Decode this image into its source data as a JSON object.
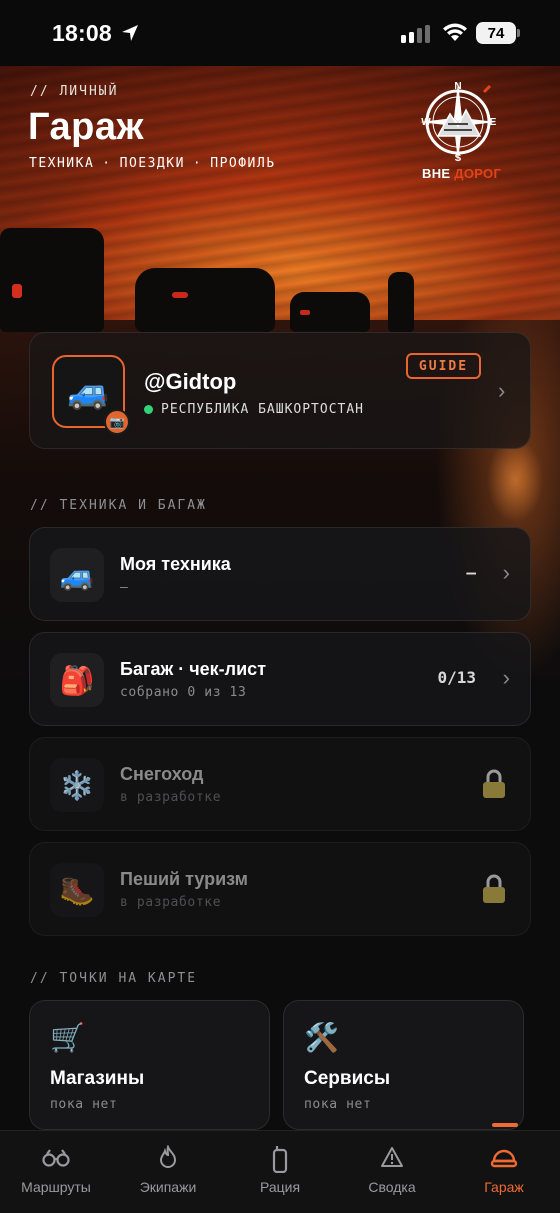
{
  "status": {
    "time": "18:08",
    "battery": "74"
  },
  "header": {
    "tag": "// ЛИЧНЫЙ",
    "title": "Гараж",
    "nav": [
      "ТЕХНИКА",
      "·",
      "ПОЕЗДКИ",
      "·",
      "ПРОФИЛЬ"
    ],
    "logo": {
      "compass": [
        "N",
        "W",
        "E",
        "S"
      ],
      "text_white": "ВНЕ",
      "text_red": "ДОРОГ"
    }
  },
  "profile": {
    "avatar_emoji": "🚙",
    "camera_emoji": "📷",
    "username": "@Gidtop",
    "region": "РЕСПУБЛИКА БАШКОРТОСТАН",
    "badge": "GUIDE",
    "online_color": "#33d17a"
  },
  "section_gear": {
    "title": "// ТЕХНИКА И БАГАЖ",
    "items": [
      {
        "emoji": "🚙",
        "title": "Моя техника",
        "subtitle": "—",
        "value": "—",
        "locked": false
      },
      {
        "emoji": "🎒",
        "title": "Багаж · чек-лист",
        "subtitle": "собрано 0 из 13",
        "value": "0/13",
        "locked": false
      },
      {
        "emoji": "❄️",
        "title": "Снегоход",
        "subtitle": "в разработке",
        "locked": true
      },
      {
        "emoji": "🥾",
        "title": "Пеший туризм",
        "subtitle": "в разработке",
        "locked": true
      }
    ]
  },
  "section_map": {
    "title": "// ТОЧКИ НА КАРТЕ",
    "tiles": [
      {
        "emoji": "🛒",
        "title": "Магазины",
        "subtitle": "пока нет"
      },
      {
        "emoji": "🛠️",
        "title": "Сервисы",
        "subtitle": "пока нет"
      }
    ]
  },
  "tabs": [
    {
      "label": "Маршруты",
      "icon": "binoculars-icon"
    },
    {
      "label": "Экипажи",
      "icon": "flame-icon"
    },
    {
      "label": "Рация",
      "icon": "radio-icon"
    },
    {
      "label": "Сводка",
      "icon": "warning-icon"
    },
    {
      "label": "Гараж",
      "icon": "helmet-icon",
      "active": true
    }
  ],
  "colors": {
    "accent": "#ef6b33",
    "background": "#0c0c0d"
  }
}
